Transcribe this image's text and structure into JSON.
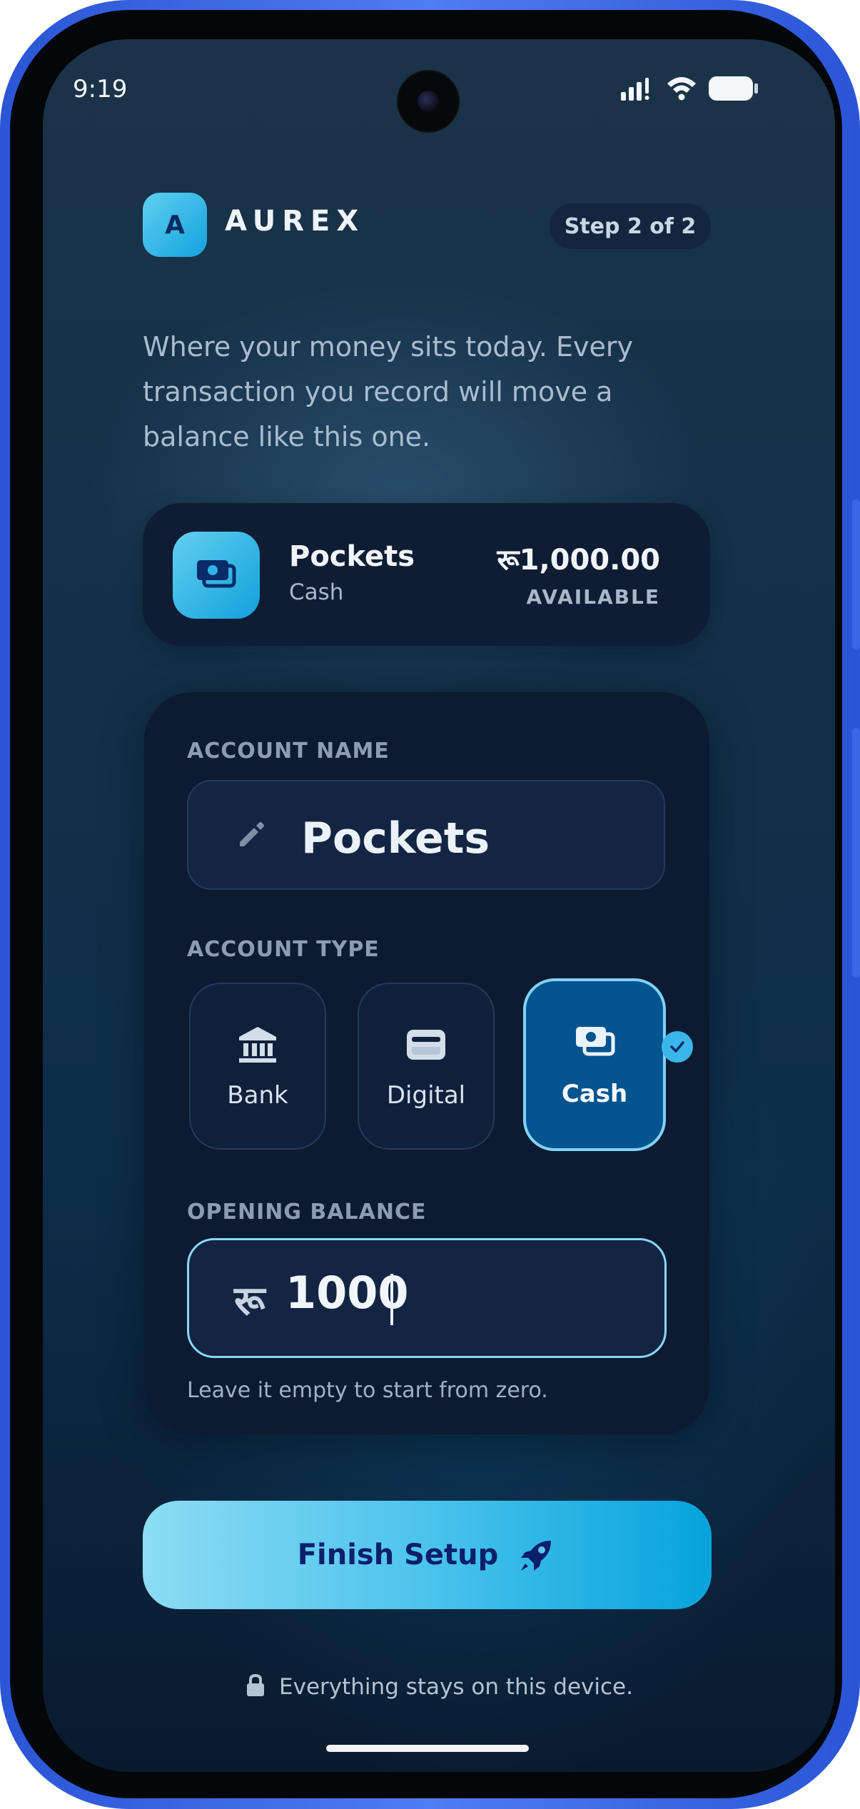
{
  "status_bar": {
    "time": "9:19"
  },
  "header": {
    "logo_letter": "A",
    "brand": "AUREX",
    "step": "Step 2 of 2"
  },
  "intro_text": "Where your money sits today. Every transaction you record will move a balance like this one.",
  "summary": {
    "icon": "cash-icon",
    "name": "Pockets",
    "type": "Cash",
    "amount": "रू1,000.00",
    "amount_label": "AVAILABLE"
  },
  "form": {
    "account_name_label": "ACCOUNT NAME",
    "account_name_value": "Pockets",
    "account_type_label": "ACCOUNT TYPE",
    "account_types": [
      {
        "label": "Bank",
        "icon": "bank-icon",
        "selected": false
      },
      {
        "label": "Digital",
        "icon": "wallet-icon",
        "selected": false
      },
      {
        "label": "Cash",
        "icon": "cash-icon",
        "selected": true
      }
    ],
    "opening_balance_label": "OPENING BALANCE",
    "currency_symbol": "रू",
    "opening_balance_value": "1000",
    "hint": "Leave it empty to start from zero."
  },
  "finish_button": {
    "label": "Finish Setup",
    "icon": "rocket-icon"
  },
  "footer_note": "Everything stays on this device.",
  "colors": {
    "accent": "#13a2de",
    "selected_tile": "#06548f",
    "button_text": "#0b1f6b"
  }
}
